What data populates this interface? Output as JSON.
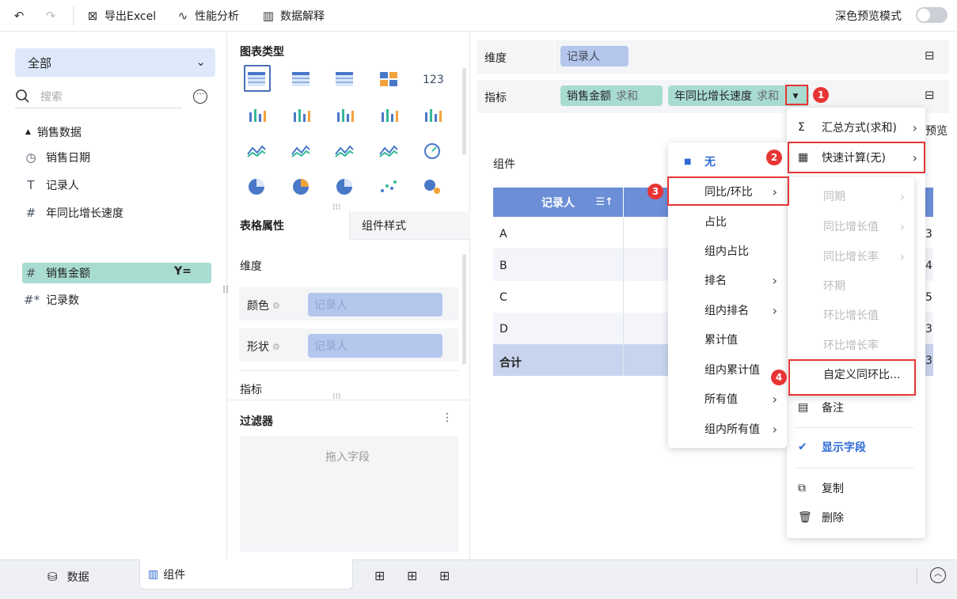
{
  "toolbar": {
    "export_label": "导出Excel",
    "perf_label": "性能分析",
    "explain_label": "数据解释",
    "dark_mode_label": "深色预览模式"
  },
  "left": {
    "dataset_select": "全部",
    "search_placeholder": "搜索",
    "tree_root": "销售数据",
    "fields": [
      {
        "icon": "clock-icon",
        "label": "销售日期"
      },
      {
        "icon": "text-type-icon",
        "label": "记录人"
      },
      {
        "icon": "number-type-icon",
        "label": "年同比增长速度"
      },
      {
        "icon": "number-type-icon",
        "label": "销售金额"
      },
      {
        "icon": "calculated-number-icon",
        "label": "记录数"
      }
    ]
  },
  "middle": {
    "chart_type_title": "图表类型",
    "tab_table_props": "表格属性",
    "tab_component_style": "组件样式",
    "dimension_label": "维度",
    "color_label": "颜色",
    "color_value": "记录人",
    "shape_label": "形状",
    "shape_value": "记录人",
    "metric_label": "指标",
    "filter_title": "过滤器",
    "filter_drop": "拖入字段"
  },
  "right": {
    "dimension_label": "维度",
    "dimension_pill": "记录人",
    "metric_label": "指标",
    "metric_pill1_name": "销售金额",
    "metric_pill1_agg": "求和",
    "metric_pill2_name": "年同比增长速度",
    "metric_pill2_agg": "求和",
    "component_label": "组件",
    "preview_partial": "预览",
    "table": {
      "header": "记录人",
      "rows": [
        "A",
        "B",
        "C",
        "D"
      ],
      "total": "合计",
      "right_digits": [
        "3",
        "4",
        "5",
        "3",
        "3"
      ]
    }
  },
  "menu_main": {
    "summary": "汇总方式(求和)",
    "quick_calc": "快速计算(无)",
    "note": "备注",
    "show_field": "显示字段",
    "copy": "复制",
    "delete": "删除"
  },
  "menu_quick": {
    "none": "无",
    "yoy_mom": "同比/环比",
    "ratio": "占比",
    "group_ratio": "组内占比",
    "rank": "排名",
    "group_rank": "组内排名",
    "cumulative": "累计值",
    "group_cumulative": "组内累计值",
    "all_values": "所有值",
    "group_all_values": "组内所有值"
  },
  "menu_yoy": {
    "same_period": "同期",
    "yoy_growth_value": "同比增长值",
    "yoy_growth_rate": "同比增长率",
    "prev_period": "环期",
    "mom_growth_value": "环比增长值",
    "mom_growth_rate": "环比增长率",
    "custom": "自定义同环比..."
  },
  "badges": [
    "1",
    "2",
    "3",
    "4"
  ],
  "bottom": {
    "data_tab": "数据",
    "component_tab": "组件"
  },
  "colors": {
    "accent_blue": "#6b8ed6",
    "pill_blue": "#b4c6ec",
    "pill_green": "#a9dcd1",
    "highlight_red": "#e63636",
    "checked_blue": "#2f6bd6"
  }
}
